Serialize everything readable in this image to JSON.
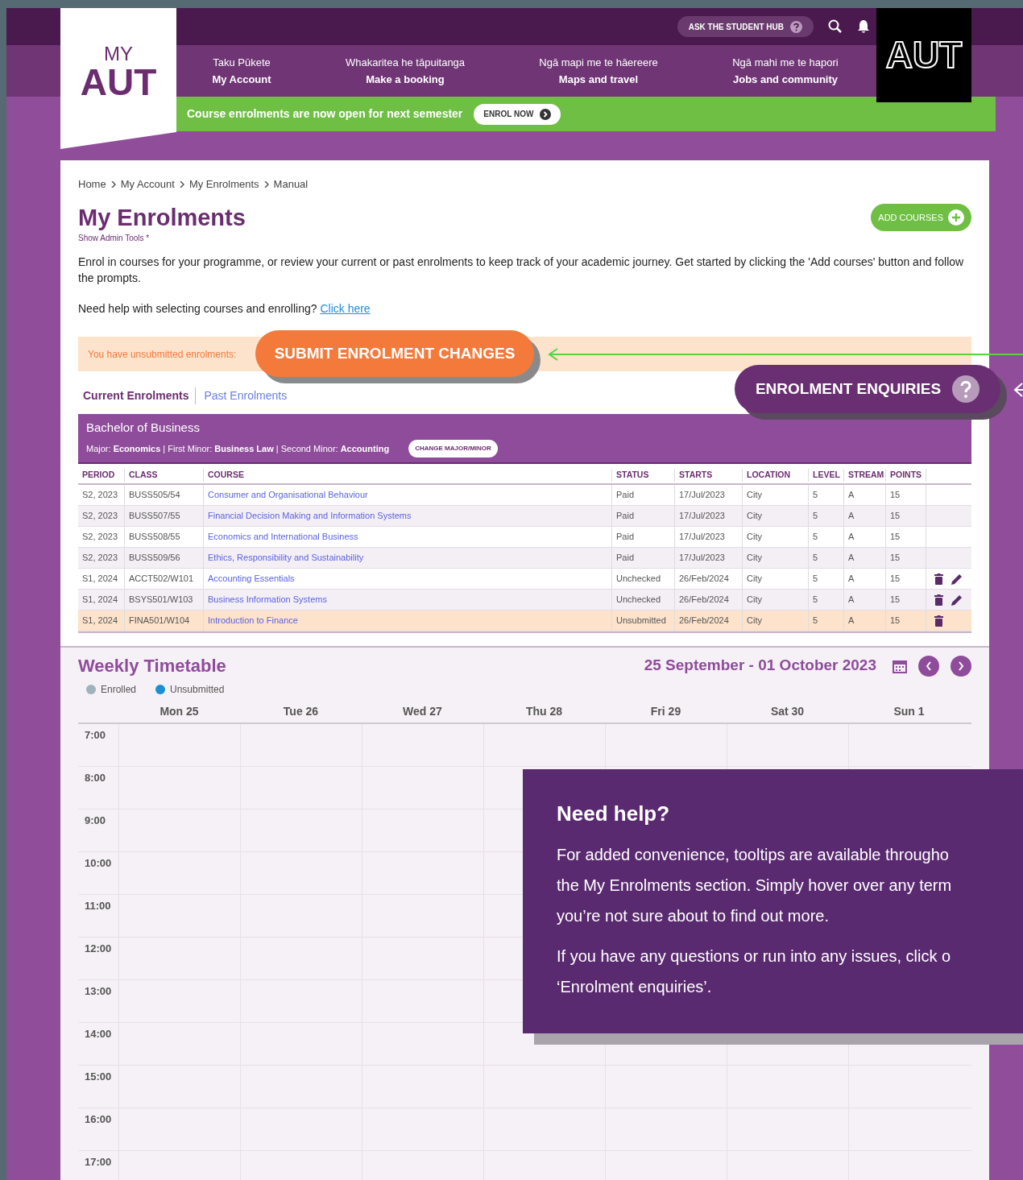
{
  "top_bar": {
    "hub_button": "ASK THE STUDENT HUB"
  },
  "logo": {
    "line_1": "MY",
    "line_2": "AUT"
  },
  "brand_logo": "AUT",
  "nav": [
    {
      "maori": "Taku Pūkete",
      "english": "My Account"
    },
    {
      "maori": "Whakaritea he tāpuitanga",
      "english": "Make a booking"
    },
    {
      "maori": "Ngā mapi me te hāereere",
      "english": "Maps and travel"
    },
    {
      "maori": "Ngā mahi me te hapori",
      "english": "Jobs and community"
    }
  ],
  "banner": {
    "text": "Course enrolments are now open for next semester",
    "button": "ENROL NOW"
  },
  "breadcrumb": [
    "Home",
    "My Account",
    "My Enrolments",
    "Manual"
  ],
  "page_title": "My Enrolments",
  "add_courses": "ADD COURSES",
  "admin_tools": "Show Admin Tools *",
  "intro": "Enrol in courses for your programme, or review your current or past enrolments to keep track of your academic journey. Get started by clicking the 'Add courses' button and follow the prompts.",
  "help_line": {
    "text": "Need help with selecting courses and enrolling?",
    "link": "Click here"
  },
  "notice": {
    "text": "You have unsubmitted enrolments:",
    "button": "SUBMIT ENROLMENT CHANGES"
  },
  "enquiries_button": "ENROLMENT ENQUIRIES",
  "tabs": [
    {
      "label": "Current Enrolments",
      "selected": true
    },
    {
      "label": "Past Enrolments",
      "selected": false
    }
  ],
  "programme": {
    "title": "Bachelor of Business",
    "details": "Major: **Economics** | First Minor: **Business Law** | Second Minor: **Accounting**",
    "button": "CHANGE MAJOR/MINOR"
  },
  "table": {
    "columns": [
      "PERIOD",
      "CLASS",
      "COURSE",
      "STATUS",
      "STARTS",
      "LOCATION",
      "LEVEL",
      "STREAM",
      "POINTS"
    ],
    "rows": [
      {
        "cells": [
          "S2, 2023",
          "BUSS505/54",
          "Consumer and Organisational Behaviour",
          "Paid",
          "17/Jul/2023",
          "City",
          "5",
          "A",
          "15"
        ],
        "highlighted": false,
        "can_delete": false,
        "can_edit": false
      },
      {
        "cells": [
          "S2, 2023",
          "BUSS507/55",
          "Financial Decision Making and Information Systems",
          "Paid",
          "17/Jul/2023",
          "City",
          "5",
          "A",
          "15"
        ],
        "highlighted": false,
        "can_delete": false,
        "can_edit": false
      },
      {
        "cells": [
          "S2, 2023",
          "BUSS508/55",
          "Economics and International Business",
          "Paid",
          "17/Jul/2023",
          "City",
          "5",
          "A",
          "15"
        ],
        "highlighted": false,
        "can_delete": false,
        "can_edit": false
      },
      {
        "cells": [
          "S2, 2023",
          "BUSS509/56",
          "Ethics, Responsibility and Sustainability",
          "Paid",
          "17/Jul/2023",
          "City",
          "5",
          "A",
          "15"
        ],
        "highlighted": false,
        "can_delete": false,
        "can_edit": false
      },
      {
        "cells": [
          "S1, 2024",
          "ACCT502/W101",
          "Accounting Essentials",
          "Unchecked",
          "26/Feb/2024",
          "City",
          "5",
          "A",
          "15"
        ],
        "highlighted": false,
        "can_delete": true,
        "can_edit": true
      },
      {
        "cells": [
          "S1, 2024",
          "BSYS501/W103",
          "Business Information Systems",
          "Unchecked",
          "26/Feb/2024",
          "City",
          "5",
          "A",
          "15"
        ],
        "highlighted": false,
        "can_delete": true,
        "can_edit": true
      },
      {
        "cells": [
          "S1, 2024",
          "FINA501/W104",
          "Introduction to Finance",
          "Unsubmitted",
          "26/Feb/2024",
          "City",
          "5",
          "A",
          "15"
        ],
        "highlighted": true,
        "can_delete": true,
        "can_edit": false
      }
    ]
  },
  "timetable": {
    "title": "Weekly Timetable",
    "range": "25 September - 01 October 2023",
    "legend": [
      {
        "label": "Enrolled",
        "color": "#9fb3bd"
      },
      {
        "label": "Unsubmitted",
        "color": "#1a8fd6"
      }
    ],
    "days": [
      "Mon 25",
      "Tue 26",
      "Wed 27",
      "Thu 28",
      "Fri 29",
      "Sat 30",
      "Sun 1"
    ],
    "hours": [
      "7:00",
      "8:00",
      "9:00",
      "10:00",
      "11:00",
      "12:00",
      "13:00",
      "14:00",
      "15:00",
      "16:00",
      "17:00"
    ]
  },
  "help_panel": {
    "title": "Need help?",
    "paragraphs": [
      [
        "For added convenience, tooltips are available througho",
        "the My Enrolments section. Simply hover over any term",
        "you’re not sure about to find out more."
      ],
      [
        "If you have any questions or run into any issues, click o",
        "‘Enrolment enquiries’."
      ]
    ]
  }
}
